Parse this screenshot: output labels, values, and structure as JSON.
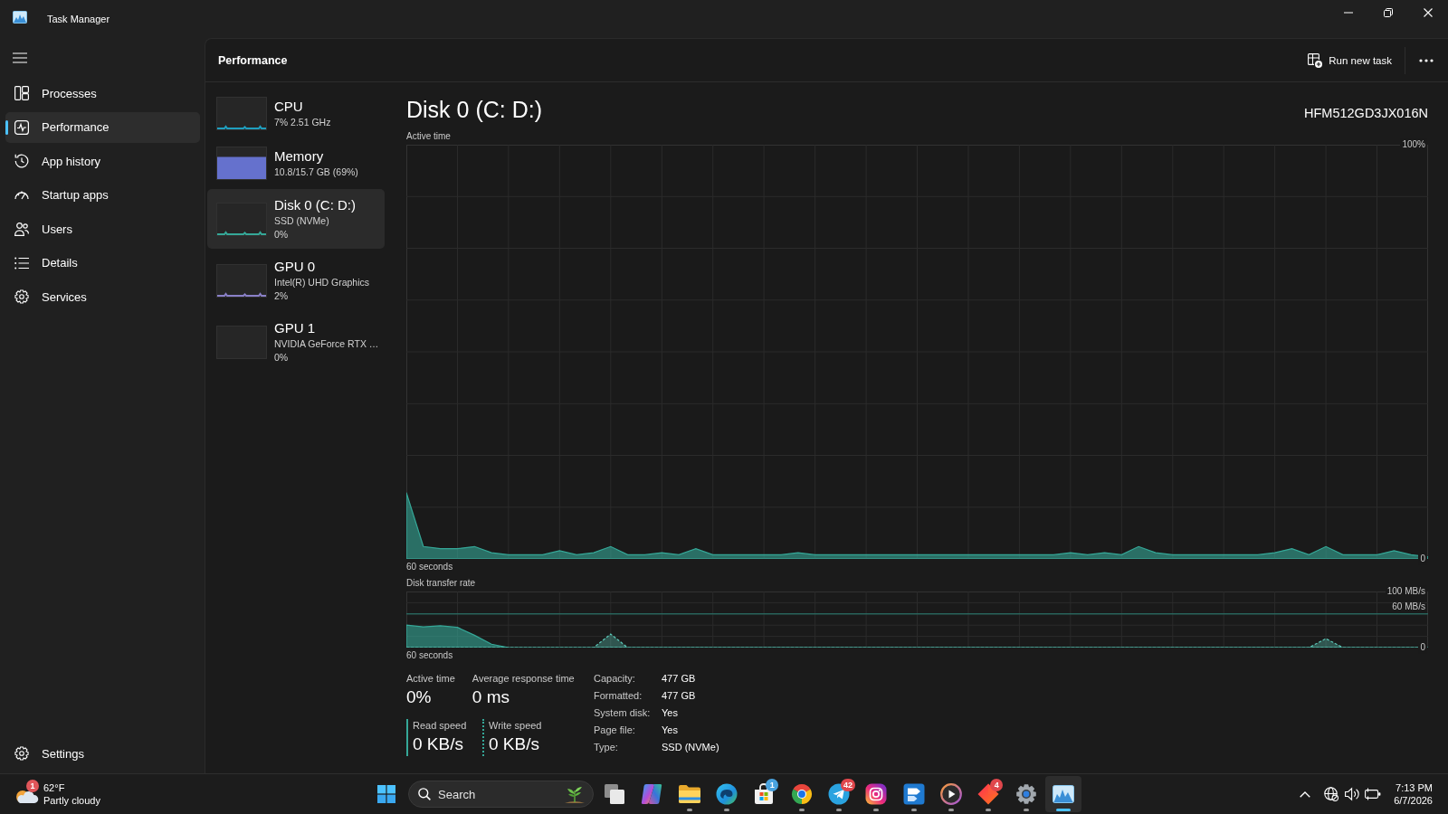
{
  "window": {
    "title": "Task Manager"
  },
  "sidebar": {
    "items": [
      {
        "label": "Processes",
        "kind": "panels",
        "selected": false
      },
      {
        "label": "Performance",
        "kind": "pulse",
        "selected": true
      },
      {
        "label": "App history",
        "kind": "history",
        "selected": false
      },
      {
        "label": "Startup apps",
        "kind": "gauge",
        "selected": false
      },
      {
        "label": "Users",
        "kind": "users",
        "selected": false
      },
      {
        "label": "Details",
        "kind": "list",
        "selected": false
      },
      {
        "label": "Services",
        "kind": "cog",
        "selected": false
      }
    ],
    "footer": {
      "label": "Settings"
    }
  },
  "header": {
    "title": "Performance",
    "run_task": {
      "label": "Run new task"
    }
  },
  "performance_list": [
    {
      "name": "CPU",
      "details": [
        "7% 2.51 GHz"
      ],
      "kind": "line",
      "color": "#1f9fbf",
      "selected": false
    },
    {
      "name": "Memory",
      "details": [
        "10.8/15.7 GB (69%)"
      ],
      "kind": "fill",
      "color": "#6571cd",
      "selected": false
    },
    {
      "name": "Disk 0 (C: D:)",
      "details": [
        "SSD (NVMe)",
        "0%"
      ],
      "kind": "line",
      "color": "#35a898",
      "selected": true
    },
    {
      "name": "GPU 0",
      "details": [
        "Intel(R) UHD Graphics",
        "2%"
      ],
      "kind": "line",
      "color": "#8a80c8",
      "selected": false
    },
    {
      "name": "GPU 1",
      "details": [
        "NVIDIA GeForce RTX …",
        "0%"
      ],
      "kind": "blank",
      "selected": false
    }
  ],
  "detail": {
    "title": "Disk 0 (C: D:)",
    "model": "HFM512GD3JX016N",
    "active_time_graph": {
      "chart_data": {
        "type": "area",
        "title": "Active time",
        "xlabel": "60 seconds",
        "ylim": [
          0,
          100
        ],
        "yticks": [
          {
            "value": 100,
            "label": "100%"
          },
          {
            "value": 0,
            "label": "0"
          }
        ],
        "grid": true,
        "series": [
          {
            "color": "#35a898",
            "values": [
              16,
              3,
              2.5,
              2.5,
              3,
              1.5,
              1,
              1,
              1,
              2,
              1,
              1.5,
              3,
              1,
              1,
              1.5,
              1,
              2.5,
              1,
              1,
              1,
              1,
              1,
              1.5,
              1,
              1,
              1,
              1,
              1,
              1,
              1,
              1,
              1,
              1,
              1,
              1,
              1,
              1,
              1,
              1.5,
              1,
              1.5,
              1,
              3,
              1.5,
              1,
              1,
              1,
              1,
              1,
              1,
              1.5,
              2.5,
              1,
              3,
              1,
              1,
              1,
              2,
              1,
              0.5
            ]
          }
        ]
      }
    },
    "transfer_rate_graph": {
      "chart_data": {
        "type": "area",
        "title": "Disk transfer rate",
        "xlabel": "60 seconds",
        "ylim": [
          0,
          100
        ],
        "yticks": [
          {
            "value": 100,
            "label": "100 MB/s"
          },
          {
            "value": 0,
            "label": "0"
          }
        ],
        "ref_lines": [
          {
            "axis": "y",
            "value": 60,
            "label": "60 MB/s"
          }
        ],
        "grid": true,
        "series": [
          {
            "color": "#35a898",
            "values": [
              40,
              37,
              39,
              36,
              22,
              6,
              0,
              0,
              0,
              0,
              0,
              0,
              0,
              0,
              0,
              0,
              0,
              0,
              0,
              0,
              0,
              0,
              0,
              0,
              0,
              0,
              0,
              0,
              0,
              0,
              0,
              0,
              0,
              0,
              0,
              0,
              0,
              0,
              0,
              0,
              0,
              0,
              0,
              0,
              0,
              0,
              0,
              0,
              0,
              0,
              0,
              0,
              0,
              0,
              0,
              0,
              0,
              0,
              0,
              0,
              0
            ]
          },
          {
            "color": "#5cc8b8",
            "values": [
              0,
              0,
              0,
              0,
              0,
              0,
              0,
              0,
              0,
              0,
              0,
              0,
              24,
              0,
              0,
              0,
              0,
              0,
              0,
              0,
              0,
              0,
              0,
              0,
              0,
              0,
              0,
              0,
              0,
              0,
              0,
              0,
              0,
              0,
              0,
              0,
              0,
              0,
              0,
              0,
              0,
              0,
              0,
              0,
              0,
              0,
              0,
              0,
              0,
              0,
              0,
              0,
              0,
              0,
              16,
              0,
              0,
              0,
              0,
              0,
              0
            ]
          }
        ]
      }
    },
    "stats": [
      {
        "label": "Active time",
        "value": "0%"
      },
      {
        "label": "Average response time",
        "value": "0 ms"
      }
    ],
    "speeds": [
      {
        "label": "Read speed",
        "value": "0 KB/s",
        "kind": "solid"
      },
      {
        "label": "Write speed",
        "value": "0 KB/s",
        "kind": "dotted"
      }
    ],
    "properties": [
      {
        "label": "Capacity:",
        "value": "477 GB"
      },
      {
        "label": "Formatted:",
        "value": "477 GB"
      },
      {
        "label": "System disk:",
        "value": "Yes"
      },
      {
        "label": "Page file:",
        "value": "Yes"
      },
      {
        "label": "Type:",
        "value": "SSD (NVMe)"
      }
    ]
  },
  "taskbar": {
    "weather": {
      "temperature": "62°F",
      "summary": "Partly cloudy",
      "badge": {
        "text": "1",
        "color": "#e0565a"
      }
    },
    "search": {
      "placeholder": "Search"
    },
    "apps": [
      {
        "kind": "task-view",
        "running": false,
        "selected": false
      },
      {
        "kind": "ribbon",
        "running": false,
        "selected": false
      },
      {
        "kind": "folder",
        "running": true,
        "selected": false
      },
      {
        "kind": "swirl",
        "running": true,
        "selected": false
      },
      {
        "kind": "bag",
        "running": false,
        "selected": false,
        "badge": {
          "text": "1",
          "color": "#4aa3df"
        }
      },
      {
        "kind": "ring",
        "running": true,
        "selected": false
      },
      {
        "kind": "plane",
        "running": true,
        "selected": false,
        "badge": {
          "text": "42",
          "color": "#e0474c"
        }
      },
      {
        "kind": "camera",
        "running": true,
        "selected": false
      },
      {
        "kind": "arrow-tile",
        "running": true,
        "selected": false
      },
      {
        "kind": "play",
        "running": true,
        "selected": false
      },
      {
        "kind": "diamond",
        "running": true,
        "selected": false,
        "badge": {
          "text": "4",
          "color": "#e0474c"
        }
      },
      {
        "kind": "gear",
        "running": true,
        "selected": false
      },
      {
        "kind": "chart-window",
        "running": true,
        "selected": true
      }
    ],
    "clock": {
      "time": "7:13 PM",
      "date": "6/7/2026"
    }
  }
}
